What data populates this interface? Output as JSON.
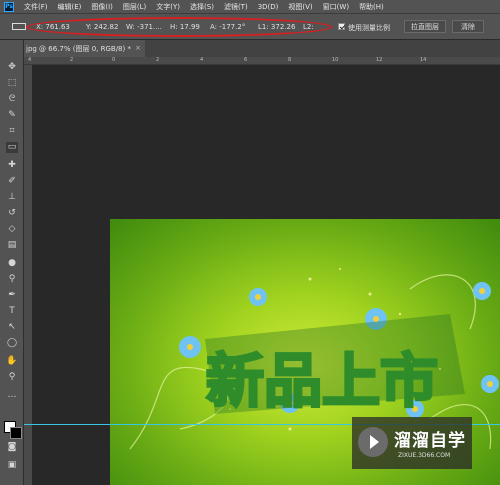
{
  "app": {
    "logo": "Ps"
  },
  "menu": [
    "文件(F)",
    "编辑(E)",
    "图像(I)",
    "图层(L)",
    "文字(Y)",
    "选择(S)",
    "滤镜(T)",
    "3D(D)",
    "视图(V)",
    "窗口(W)",
    "帮助(H)"
  ],
  "options": {
    "x": "X: 761.63",
    "y": "Y: 242.82",
    "w": "W: -371....",
    "h": "H: 17.99",
    "a": "A: -177.2°",
    "l1": "L1: 372.26",
    "l2": "L2:",
    "use_scale_label": "使用测量比例",
    "straighten_label": "拉直图层",
    "clear_label": "清除"
  },
  "document": {
    "tab_title": "jpg @ 66.7% (图层 0, RGB/8) *",
    "close": "×"
  },
  "ruler": {
    "ticks": [
      "4",
      "2",
      "0",
      "2",
      "4",
      "6",
      "8",
      "10",
      "12",
      "14"
    ]
  },
  "tools": [
    "move-icon",
    "marquee-icon",
    "lasso-icon",
    "quick-select-icon",
    "crop-icon",
    "ruler-icon",
    "healing-icon",
    "brush-icon",
    "stamp-icon",
    "history-brush-icon",
    "eraser-icon",
    "gradient-icon",
    "blur-icon",
    "dodge-icon",
    "pen-icon",
    "type-icon",
    "path-select-icon",
    "shape-icon",
    "hand-icon",
    "zoom-icon",
    "more-icon"
  ],
  "artwork": {
    "title": "新品上市"
  },
  "watermark": {
    "title": "溜溜自学",
    "subtitle": "ZIXUE.3D66.COM"
  },
  "colors": {
    "accent": "#d62020",
    "guide": "#38c6e6",
    "canvas_green": "#7fc21a",
    "text_gold": "#f2a81d",
    "text_green": "#2e8d2a"
  }
}
